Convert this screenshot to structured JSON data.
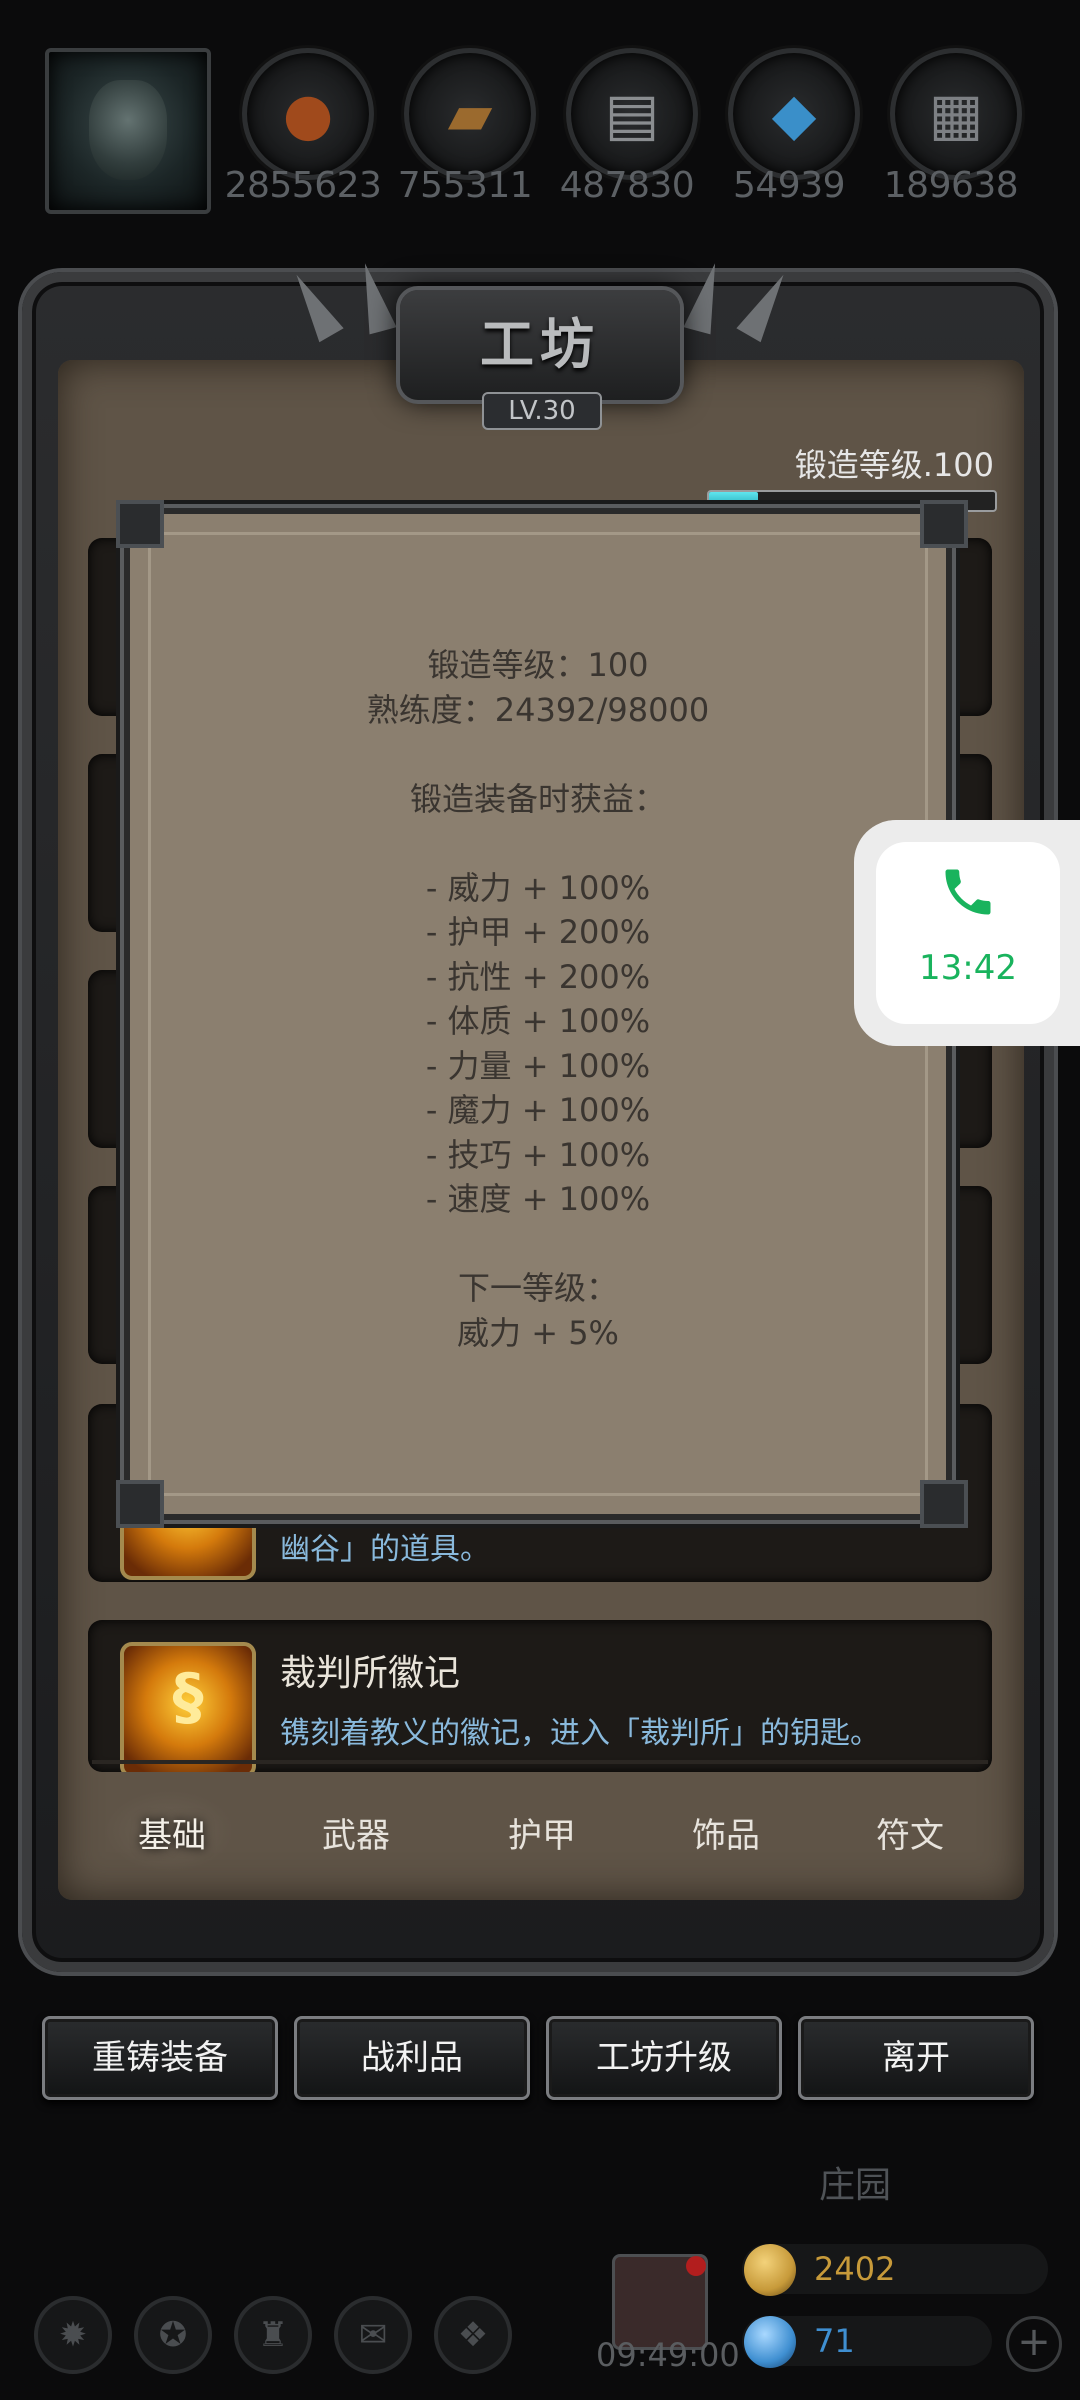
{
  "resources": [
    {
      "icon": "meat-icon",
      "value": "2855623",
      "color": "#a04a1c"
    },
    {
      "icon": "wood-icon",
      "value": "755311",
      "color": "#9b6a2e"
    },
    {
      "icon": "iron-icon",
      "value": "487830",
      "color": "#8a8d90"
    },
    {
      "icon": "crystal-icon",
      "value": "54939",
      "color": "#3a8fc9"
    },
    {
      "icon": "steel-icon",
      "value": "189638",
      "color": "#7d8084"
    }
  ],
  "panel": {
    "title": "工坊",
    "level": "LV.30",
    "forge_label": "锻造等级.100",
    "forge_progress": 0.17
  },
  "rows": [
    {
      "title": "",
      "desc": "幽谷」的道具。"
    },
    {
      "title": "裁判所徽记",
      "desc": "镌刻着教义的徽记，进入「裁判所」的钥匙。",
      "icon_glyph": "§"
    }
  ],
  "popup": {
    "lines": [
      "锻造等级：100",
      "熟练度：24392/98000",
      "",
      "锻造装备时获益：",
      "",
      "- 威力 + 100%",
      "- 护甲 + 200%",
      "- 抗性 + 200%",
      "- 体质 + 100%",
      "- 力量 + 100%",
      "- 魔力 + 100%",
      "- 技巧 + 100%",
      "- 速度 + 100%",
      "",
      "下一等级：",
      "威力 + 5%"
    ]
  },
  "tabs": [
    "基础",
    "武器",
    "护甲",
    "饰品",
    "符文"
  ],
  "active_tab": "基础",
  "buttons": [
    "重铸装备",
    "战利品",
    "工坊升级",
    "离开"
  ],
  "bottom": {
    "estate": "庄园",
    "clock": "09:49:00",
    "gold": "2402",
    "gems": "71",
    "gold_color": "#c79a3a",
    "gem_color": "#3f8fd1"
  },
  "call": {
    "time": "13:42",
    "icon": "phone-icon",
    "accent": "#19b35d"
  }
}
